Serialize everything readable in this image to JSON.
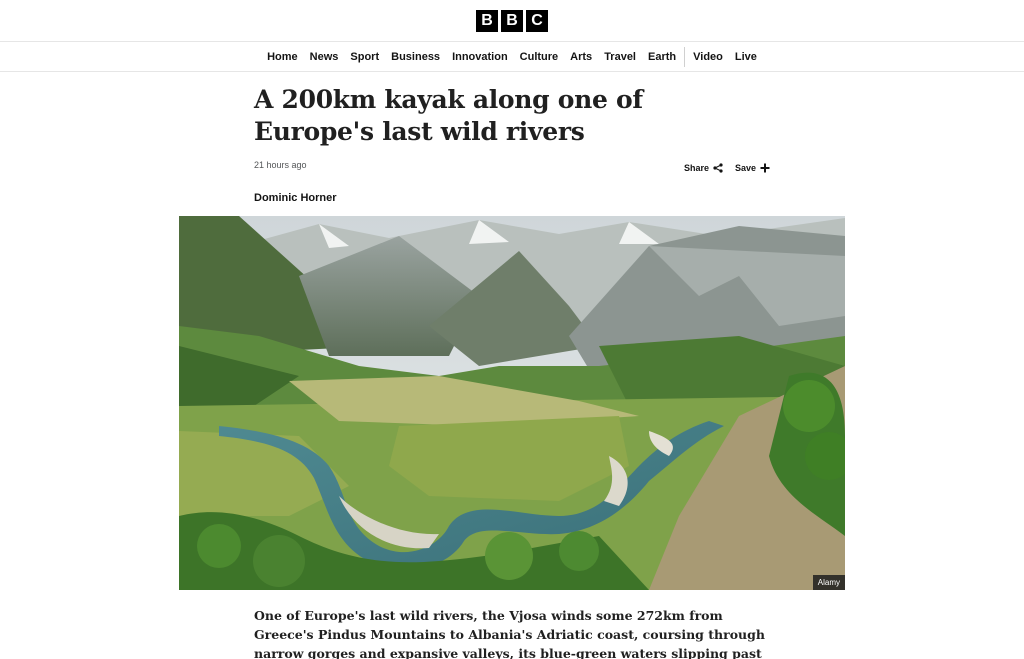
{
  "logo": {
    "letters": [
      "B",
      "B",
      "C"
    ]
  },
  "nav": {
    "items": [
      "Home",
      "News",
      "Sport",
      "Business",
      "Innovation",
      "Culture",
      "Arts",
      "Travel",
      "Earth"
    ],
    "items_after_sep": [
      "Video",
      "Live"
    ]
  },
  "article": {
    "headline": "A 200km kayak along one of Europe's last wild rivers",
    "timestamp": "21 hours ago",
    "share_label": "Share",
    "save_label": "Save",
    "author": "Dominic Horner",
    "image_credit": "Alamy",
    "intro": "One of Europe's last wild rivers, the Vjosa winds some 272km from Greece's Pindus Mountains to Albania's Adriatic coast, coursing through narrow gorges and expansive valleys, its blue-green waters slipping past Illyrian ruins, timeworn"
  },
  "colors": {
    "brand_black": "#000000",
    "text": "#141414",
    "muted": "#545658"
  },
  "icons": {
    "share": "share-icon",
    "save": "plus-icon"
  }
}
